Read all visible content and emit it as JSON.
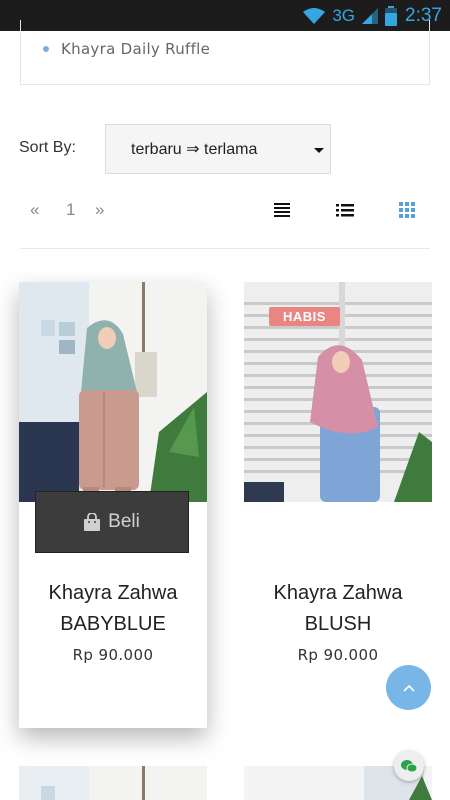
{
  "status_bar": {
    "network": "3G",
    "time": "2:37",
    "icons": [
      "wifi-icon",
      "signal-icon",
      "battery-icon"
    ]
  },
  "category_list": {
    "items": [
      "Khayra Daily Ruffle"
    ]
  },
  "sort": {
    "label": "Sort By:",
    "selected": "terbaru ⇒ terlama"
  },
  "pagination": {
    "prev": "«",
    "current": "1",
    "next": "»"
  },
  "view_modes": [
    "grid-large-icon",
    "list-icon",
    "grid-small-icon"
  ],
  "products": [
    {
      "title_line1": "Khayra Zahwa",
      "title_line2": "BABYBLUE",
      "price": "Rp 90.000",
      "buy_label": "Beli",
      "badge": ""
    },
    {
      "title_line1": "Khayra Zahwa",
      "title_line2": "BLUSH",
      "price": "Rp 90.000",
      "buy_label": "",
      "badge": "HABIS"
    }
  ],
  "colors": {
    "accent": "#78b6e8",
    "badge": "#e98683",
    "buy_button": "#3c3c3c",
    "status_bar": "#1c1c1c"
  }
}
